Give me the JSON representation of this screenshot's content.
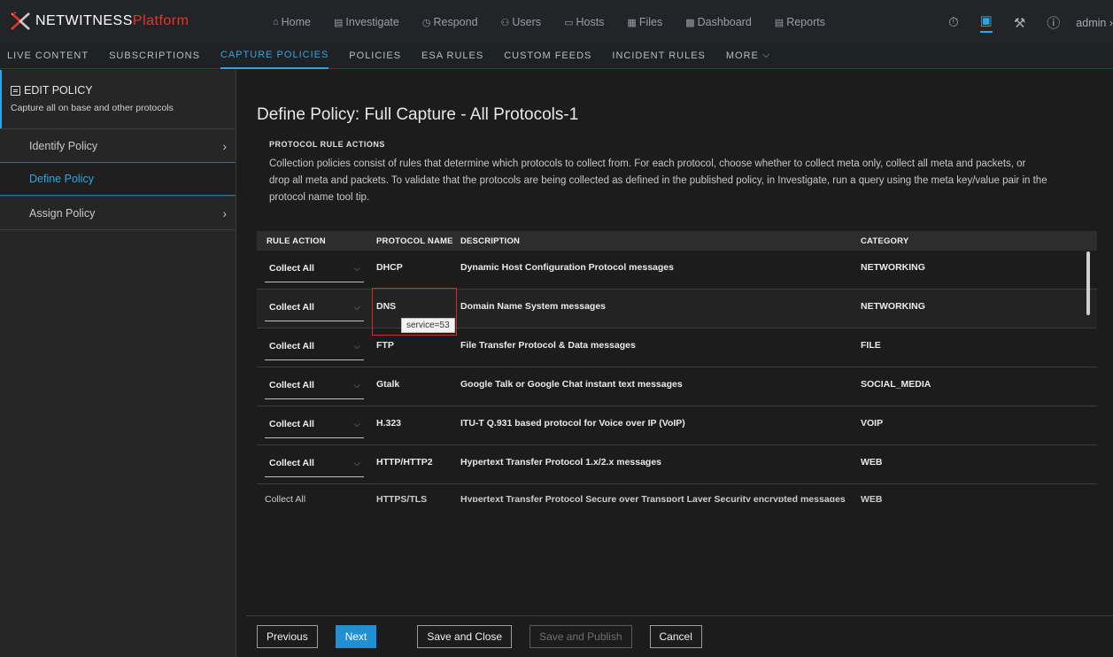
{
  "app": {
    "brand_main": "NETWITNESS",
    "brand_accent": "Platform"
  },
  "colors": {
    "accent": "#2ea7e0",
    "brand_red": "#e2352c",
    "callout_red": "#d42b2b"
  },
  "nav": [
    {
      "icon": "home-icon",
      "glyph": "⌂",
      "label": "Home"
    },
    {
      "icon": "investigate-icon",
      "glyph": "▤",
      "label": "Investigate"
    },
    {
      "icon": "respond-icon",
      "glyph": "◷",
      "label": "Respond"
    },
    {
      "icon": "users-icon",
      "glyph": "⚇",
      "label": "Users"
    },
    {
      "icon": "hosts-icon",
      "glyph": "▭",
      "label": "Hosts"
    },
    {
      "icon": "files-icon",
      "glyph": "▦",
      "label": "Files"
    },
    {
      "icon": "dashboard-icon",
      "glyph": "▩",
      "label": "Dashboard"
    },
    {
      "icon": "reports-icon",
      "glyph": "▤",
      "label": "Reports"
    }
  ],
  "tools": {
    "user": "admin"
  },
  "subnav": [
    {
      "label": "LIVE CONTENT"
    },
    {
      "label": "SUBSCRIPTIONS"
    },
    {
      "label": "CAPTURE POLICIES"
    },
    {
      "label": "POLICIES"
    },
    {
      "label": "ESA RULES"
    },
    {
      "label": "CUSTOM FEEDS"
    },
    {
      "label": "INCIDENT RULES"
    },
    {
      "label": "MORE"
    }
  ],
  "sidebar": {
    "title": "EDIT POLICY",
    "subtitle": "Capture all on base and other protocols",
    "steps": [
      {
        "label": "Identify Policy"
      },
      {
        "label": "Define Policy"
      },
      {
        "label": "Assign Policy"
      }
    ]
  },
  "main": {
    "title": "Define Policy: Full Capture - All Protocols-1",
    "section_label": "PROTOCOL RULE ACTIONS",
    "description": "Collection policies consist of rules that determine which protocols to collect from. For each protocol, choose whether to collect meta only, collect all meta and packets, or drop all meta and packets. To validate that the protocols are being collected as defined in the published policy, in Investigate, run a query using the meta key/value pair in the protocol name tool tip."
  },
  "table": {
    "headers": {
      "rule_action": "RULE ACTION",
      "protocol_name": "PROTOCOL NAME",
      "description": "DESCRIPTION",
      "category": "CATEGORY"
    },
    "rows": [
      {
        "action": "Collect All",
        "protocol": "DHCP",
        "description": "Dynamic Host Configuration Protocol messages",
        "category": "NETWORKING"
      },
      {
        "action": "Collect All",
        "protocol": "DNS",
        "description": "Domain Name System messages",
        "category": "NETWORKING",
        "tooltip": "service=53"
      },
      {
        "action": "Collect All",
        "protocol": "FTP",
        "description": "File Transfer Protocol & Data messages",
        "category": "FILE"
      },
      {
        "action": "Collect All",
        "protocol": "Gtalk",
        "description": "Google Talk or Google Chat instant text messages",
        "category": "SOCIAL_MEDIA"
      },
      {
        "action": "Collect All",
        "protocol": "H.323",
        "description": "ITU-T Q.931 based protocol for Voice over IP (VoIP)",
        "category": "VOIP"
      },
      {
        "action": "Collect All",
        "protocol": "HTTP/HTTP2",
        "description": "Hypertext Transfer Protocol 1.x/2.x messages",
        "category": "WEB"
      },
      {
        "action": "Collect All",
        "protocol": "HTTPS/TLS",
        "description": "Hypertext Transfer Protocol Secure over Transport Layer Security encrypted messages",
        "category": "WEB"
      }
    ]
  },
  "footer": {
    "previous": "Previous",
    "next": "Next",
    "save_close": "Save and Close",
    "save_publish": "Save and Publish",
    "cancel": "Cancel"
  }
}
